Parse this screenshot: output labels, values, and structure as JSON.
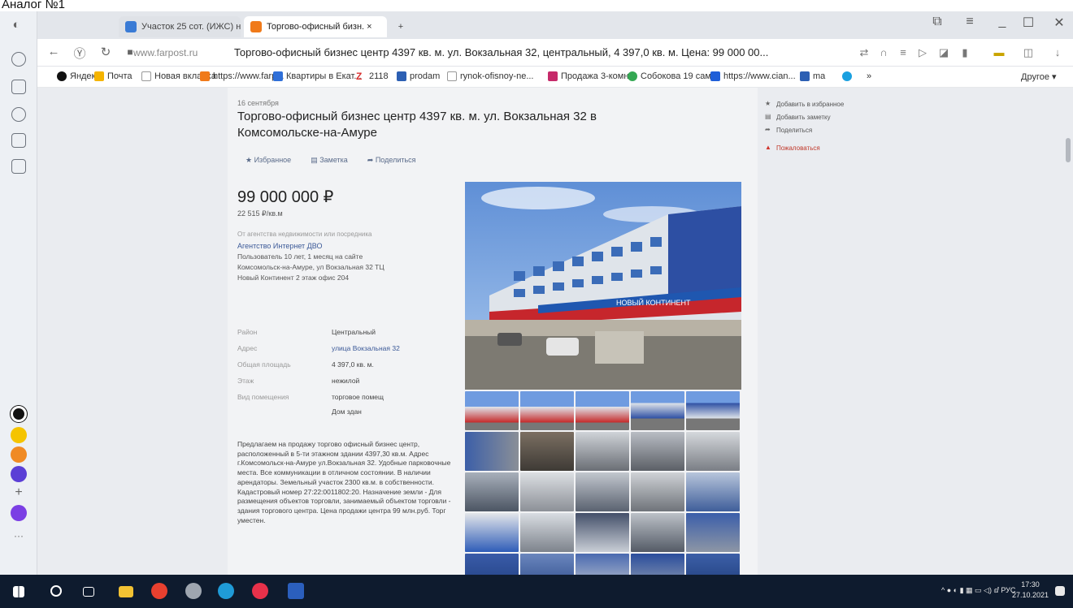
{
  "caption": "Аналог №1",
  "browser": {
    "tabs": [
      {
        "label": "Участок 25 сот. (ИЖС) на ..."
      },
      {
        "label": "Торгово-офисный бизн. ×"
      }
    ],
    "new_tab": "+",
    "window_controls": [
      "⧉",
      "≡",
      "_",
      "☐",
      "✕"
    ],
    "address": {
      "domain": "www.farpost.ru",
      "title": "Торгово-офисный бизнес центр 4397 кв. м. ул. Вокзальная 32, центральный, 4 397,0 кв. м. Цена: 99 000 00..."
    },
    "bookmarks": [
      "Яндекс",
      "Почта",
      "Новая вкладка",
      "https://www.farp...",
      "Квартиры в Екат...",
      "2118",
      "prodam",
      "rynok-ofisnoy-ne...",
      "Продажа 3-комн...",
      "Собокова 19 сам...",
      "https://www.cian...",
      "ma",
      "»",
      "Другое ▾"
    ]
  },
  "listing": {
    "date": "16 сентября",
    "title": "Торгово-офисный бизнес центр 4397 кв. м. ул. Вокзальная 32 в Комсомольске-на-Амуре",
    "actions": [
      "★ Избранное",
      "▤ Заметка",
      "➦ Поделиться"
    ],
    "price": "99 000 000 ₽",
    "price_per_m2": "22 515 ₽/кв.м",
    "agency_note": "От агентства недвижимости или посредника",
    "agency_name": "Агентство Интернет ДВО",
    "agency_lines": [
      "Пользователь 10 лет, 1 месяц на сайте",
      "Комсомольск-на-Амуре, ул Вокзальная 32 ТЦ",
      "Новый Континент 2 этаж офис 204"
    ],
    "props": [
      {
        "k": "Район",
        "v": "Центральный",
        "link": false
      },
      {
        "k": "Адрес",
        "v": "улица Вокзальная 32",
        "link": true
      },
      {
        "k": "Общая площадь",
        "v": "4 397,0 кв. м.",
        "link": false
      },
      {
        "k": "Этаж",
        "v": "нежилой",
        "link": false
      },
      {
        "k": "Вид помещения",
        "v": "торговое помещ",
        "link": false
      },
      {
        "k": "",
        "v": "Дом здан",
        "link": false
      }
    ],
    "description": "Предлагаем на продажу торгово офисный бизнес центр, расположенный в 5-ти этажном здании 4397,30 кв.м. Адрес г.Комсомольск-на-Амуре ул.Вокзальная 32. Удобные парковочные места. Все коммуникации в отличном состоянии. В наличии арендаторы. Земельный участок 2300 кв.м. в собственности. Кадастровый номер 27:22:0011802:20. Назначение земли - Для размещения объектов торговли, занимаемый объектом торговли - здания торгового центра. Цена продажи центра 99 млн.руб. Торг уместен.",
    "banner_text": "НОВЫЙ КОНТИНЕНТ",
    "sidebar": [
      {
        "label": "Добавить в избранное",
        "icon": "star-icon",
        "glyph": "★"
      },
      {
        "label": "Добавить заметку",
        "icon": "note-icon",
        "glyph": "▤"
      },
      {
        "label": "Поделиться",
        "icon": "share-icon",
        "glyph": "➦"
      },
      {
        "label": "Пожаловаться",
        "icon": "warning-icon",
        "glyph": "▲"
      }
    ]
  },
  "taskbar": {
    "tray_text": "^ ● ◐ ▮ ▦ ▭ ◁) ⅆ РУС",
    "time": "17:30",
    "date": "27.10.2021"
  },
  "colors": {
    "accent": "#3b5998",
    "sky": "#8fb5e6",
    "taskbar": "#0e1b2e"
  }
}
